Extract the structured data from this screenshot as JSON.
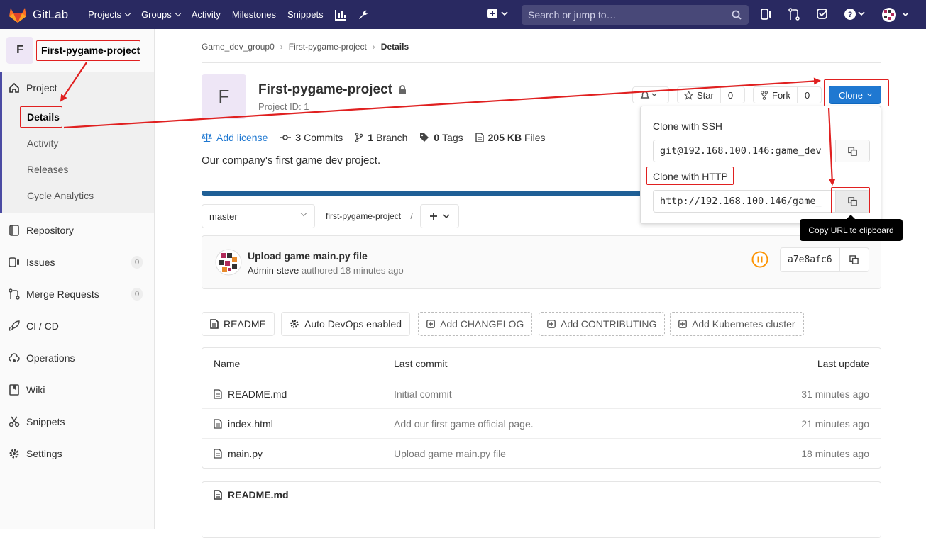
{
  "app": {
    "name": "GitLab"
  },
  "topnav": {
    "items": [
      {
        "label": "Projects",
        "dropdown": true
      },
      {
        "label": "Groups",
        "dropdown": true
      },
      {
        "label": "Activity"
      },
      {
        "label": "Milestones"
      },
      {
        "label": "Snippets"
      }
    ],
    "search_placeholder": "Search or jump to…"
  },
  "sidebar": {
    "avatar_letter": "F",
    "project_name": "First-pygame-project",
    "items": [
      {
        "label": "Project",
        "icon": "home-icon"
      },
      {
        "label": "Repository",
        "icon": "book-icon"
      },
      {
        "label": "Issues",
        "icon": "issues-icon",
        "count": "0"
      },
      {
        "label": "Merge Requests",
        "icon": "merge-request-icon",
        "count": "0"
      },
      {
        "label": "CI / CD",
        "icon": "rocket-icon"
      },
      {
        "label": "Operations",
        "icon": "cloud-gear-icon"
      },
      {
        "label": "Wiki",
        "icon": "wiki-book-icon"
      },
      {
        "label": "Snippets",
        "icon": "scissors-icon"
      },
      {
        "label": "Settings",
        "icon": "gear-icon"
      }
    ],
    "subitems": [
      "Details",
      "Activity",
      "Releases",
      "Cycle Analytics"
    ]
  },
  "breadcrumb": [
    "Game_dev_group0",
    "First-pygame-project",
    "Details"
  ],
  "project": {
    "avatar_letter": "F",
    "title": "First-pygame-project",
    "id_text": "Project ID: 1",
    "description": "Our company's first game dev project."
  },
  "actions": {
    "star_label": "Star",
    "star_count": "0",
    "fork_label": "Fork",
    "fork_count": "0",
    "clone_label": "Clone"
  },
  "stats": {
    "add_license": "Add license",
    "commits_num": "3",
    "commits_label": "Commits",
    "branch_num": "1",
    "branch_label": "Branch",
    "tags_num": "0",
    "tags_label": "Tags",
    "files_size": "205 KB",
    "files_label": "Files"
  },
  "repo": {
    "branch": "master",
    "path": "first-pygame-project",
    "path_sep": "/"
  },
  "commit": {
    "title": "Upload game main.py file",
    "author": "Admin-steve",
    "meta": "authored 18 minutes ago",
    "sha": "a7e8afc6"
  },
  "pills": [
    {
      "label": "README",
      "icon": "file-icon",
      "dashed": false
    },
    {
      "label": "Auto DevOps enabled",
      "icon": "gear-icon",
      "dashed": false
    },
    {
      "label": "Add CHANGELOG",
      "icon": "plus-square-icon",
      "dashed": true
    },
    {
      "label": "Add CONTRIBUTING",
      "icon": "plus-square-icon",
      "dashed": true
    },
    {
      "label": "Add Kubernetes cluster",
      "icon": "plus-square-icon",
      "dashed": true
    }
  ],
  "tree": {
    "headers": [
      "Name",
      "Last commit",
      "Last update"
    ],
    "rows": [
      {
        "name": "README.md",
        "commit": "Initial commit",
        "updated": "31 minutes ago"
      },
      {
        "name": "index.html",
        "commit": "Add our first game official page.",
        "updated": "21 minutes ago"
      },
      {
        "name": "main.py",
        "commit": "Upload game main.py file",
        "updated": "18 minutes ago"
      }
    ]
  },
  "readme": {
    "title": "README.md"
  },
  "clone_dropdown": {
    "ssh_label": "Clone with SSH",
    "ssh_url": "git@192.168.100.146:game_dev",
    "http_label": "Clone with HTTP",
    "http_url": "http://192.168.100.146/game_"
  },
  "tooltip": "Copy URL to clipboard",
  "colors": {
    "topbar": "#292961",
    "accent": "#1f78d1",
    "annotation": "#e02020"
  }
}
